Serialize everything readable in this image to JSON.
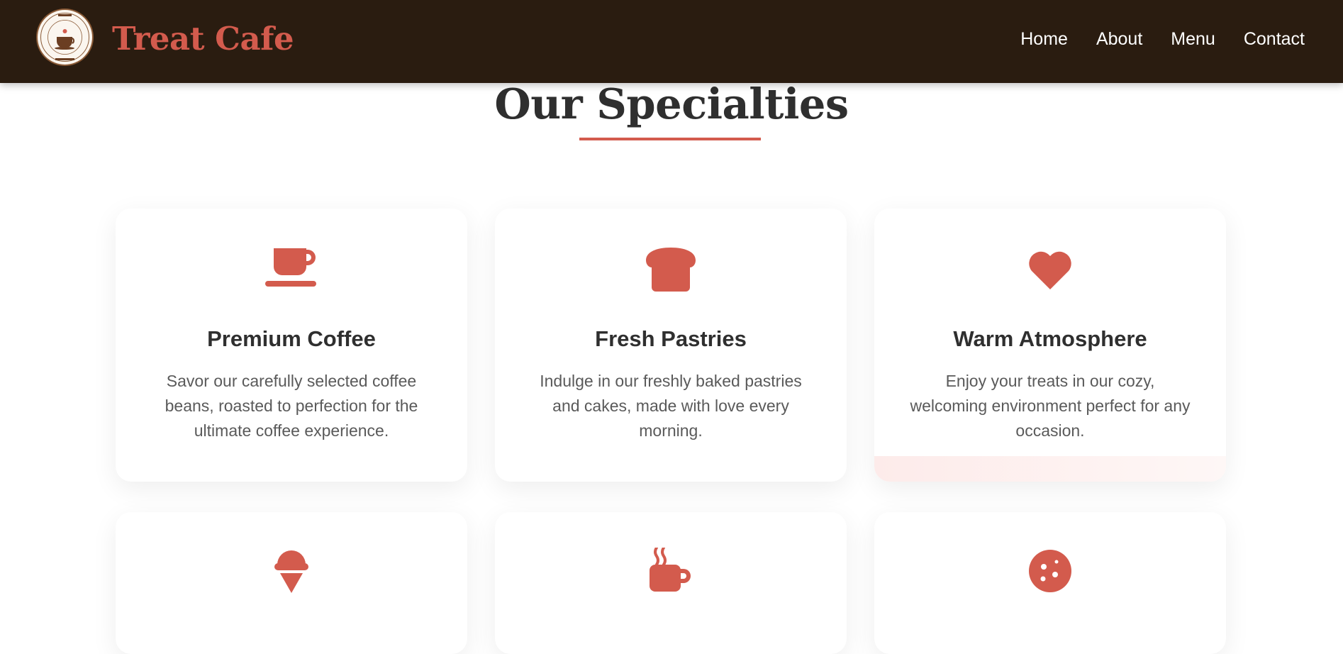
{
  "header": {
    "brand": "Treat Cafe",
    "logo_text_top": "TREAT CAFE",
    "logo_text_bottom": "DAY STARTS SMILE",
    "nav": [
      "Home",
      "About",
      "Menu",
      "Contact"
    ]
  },
  "section": {
    "title": "Our Specialties"
  },
  "cards": [
    {
      "icon": "coffee-cup-icon",
      "title": "Premium Coffee",
      "text": "Savor our carefully selected coffee beans, roasted to perfection for the ultimate coffee experience."
    },
    {
      "icon": "bread-icon",
      "title": "Fresh Pastries",
      "text": "Indulge in our freshly baked pastries and cakes, made with love every morning."
    },
    {
      "icon": "heart-icon",
      "title": "Warm Atmosphere",
      "text": "Enjoy your treats in our cozy, welcoming environment perfect for any occasion."
    },
    {
      "icon": "ice-cream-icon",
      "title": "",
      "text": ""
    },
    {
      "icon": "hot-mug-icon",
      "title": "",
      "text": ""
    },
    {
      "icon": "cookie-icon",
      "title": "",
      "text": ""
    }
  ],
  "colors": {
    "accent": "#d35b4d",
    "header_bg": "#2a1c10",
    "heading": "#2f2f2f",
    "body_text": "#5a5a5a"
  }
}
